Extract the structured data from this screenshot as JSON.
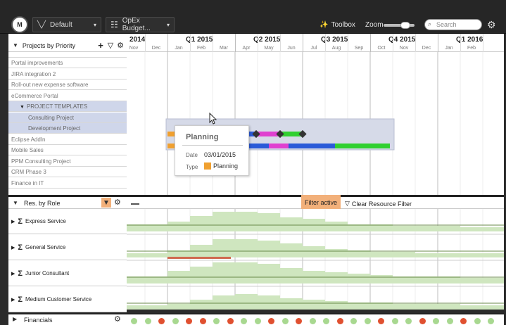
{
  "toolbar": {
    "view_label": "Default",
    "budget_label": "OpEx Budget...",
    "toolbox_label": "Toolbox",
    "zoom_label": "Zoom",
    "search_placeholder": "Search"
  },
  "timeline": {
    "quarters": [
      "2014",
      "Q1 2015",
      "Q2 2015",
      "Q3 2015",
      "Q4 2015",
      "Q1 2016"
    ],
    "months": [
      "Nov",
      "Dec",
      "Jan",
      "Feb",
      "Mar",
      "Apr",
      "May",
      "Jun",
      "Jul",
      "Aug",
      "Sep",
      "Oct",
      "Nov",
      "Dec",
      "Jan",
      "Feb"
    ]
  },
  "projects": {
    "header": "Projects by Priority",
    "rows": [
      "Portal improvements",
      "JIRA integration 2",
      "Roll-out new expense software",
      "eCommerce Portal",
      "PROJECT TEMPLATES",
      "Consulting Project",
      "Development Project",
      "Eclipse AddIn",
      "Mobile Sales",
      "PPM Consulting Project",
      "CRM Phase 3",
      "Finance in IT"
    ]
  },
  "tooltip": {
    "title": "Planning",
    "date_label": "Date",
    "date_value": "03/01/2015",
    "type_label": "Type",
    "type_value": "Planning",
    "type_color": "#f0a030"
  },
  "resources": {
    "header": "Res. by Role",
    "filter_active": "Filter active",
    "clear_filter": "Clear Resource Filter",
    "roles": [
      "Express Service",
      "General Service",
      "Junior Consultant",
      "Medium Customer Service"
    ]
  },
  "financials": {
    "label": "Financials",
    "dots": [
      "green",
      "green",
      "red",
      "green",
      "red",
      "red",
      "green",
      "red",
      "green",
      "green",
      "red",
      "green",
      "red",
      "green",
      "green",
      "red",
      "green",
      "green",
      "red",
      "green",
      "green",
      "red",
      "green",
      "green",
      "red",
      "green",
      "green"
    ]
  },
  "colors": {
    "planning": "#f0a030",
    "blue": "#2a5ad8",
    "magenta": "#e040d0",
    "green": "#30d030",
    "dot_green": "#a8d890",
    "dot_red": "#e05030"
  }
}
